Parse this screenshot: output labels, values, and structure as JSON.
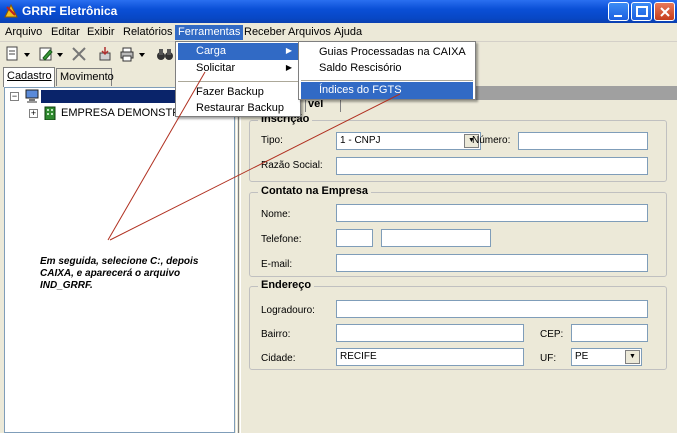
{
  "window": {
    "title": "GRRF Eletrônica"
  },
  "menubar": {
    "items": [
      "Arquivo",
      "Editar",
      "Exibir",
      "Relatórios",
      "Ferramentas",
      "Receber Arquivos",
      "Ajuda"
    ],
    "active": "Ferramentas"
  },
  "ferramentas_menu": {
    "items": [
      "Carga",
      "Solicitar",
      "Fazer Backup",
      "Restaurar Backup"
    ]
  },
  "carga_submenu": {
    "items": [
      "Guias Processadas na CAIXA",
      "Saldo Rescisório",
      "Índices do FGTS"
    ]
  },
  "left_tabs": {
    "cadastro": "Cadastro",
    "movimento": "Movimento"
  },
  "tree": {
    "company": "EMPRESA DEMONSTRA"
  },
  "annotation": "Em seguida, selecione C:, depois CAIXA, e aparecerá o arquivo IND_GRRF.",
  "right_tab": {
    "label": "vel"
  },
  "inscricao": {
    "legend": "Inscrição",
    "tipo_label": "Tipo:",
    "tipo_value": "1 - CNPJ",
    "numero_label": "Número:",
    "numero_value": "",
    "razao_label": "Razão Social:",
    "razao_value": ""
  },
  "contato": {
    "legend": "Contato na Empresa",
    "nome_label": "Nome:",
    "nome_value": "",
    "telefone_label": "Telefone:",
    "ddd_value": "",
    "telefone_value": "",
    "email_label": "E-mail:",
    "email_value": ""
  },
  "endereco": {
    "legend": "Endereço",
    "logradouro_label": "Logradouro:",
    "logradouro_value": "",
    "bairro_label": "Bairro:",
    "bairro_value": "",
    "cep_label": "CEP:",
    "cep_value": "",
    "cidade_label": "Cidade:",
    "cidade_value": "RECIFE",
    "uf_label": "UF:",
    "uf_value": "PE"
  },
  "colors": {
    "titlebar": "#0a4fd6",
    "highlight": "#316ac5",
    "tree_selection": "#0a246a",
    "face": "#ece9d8"
  }
}
